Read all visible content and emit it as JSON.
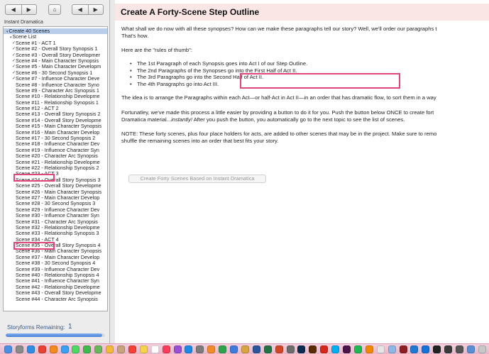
{
  "nav": {
    "back_glyph": "◀",
    "forward_glyph": "▶",
    "home_glyph": "⌂",
    "prev_glyph": "◀",
    "next_glyph": "▶"
  },
  "sidebar": {
    "document_label": "Instant Dramatica",
    "items": [
      {
        "label": "Create 40 Scenes",
        "level": 0,
        "selected": true,
        "checked": false,
        "expander": "▾"
      },
      {
        "label": "Scene List",
        "level": 1,
        "selected": false,
        "checked": false,
        "expander": "▾"
      },
      {
        "label": "Scene #1 - ACT 1",
        "level": 2,
        "checked": true
      },
      {
        "label": "Scene #2 - Overall Story Synopsis 1",
        "level": 2,
        "checked": true
      },
      {
        "label": "Scene #3 - Overall Story Developmer",
        "level": 2,
        "checked": true
      },
      {
        "label": "Scene #4 - Main Character Synopsis",
        "level": 2,
        "checked": true
      },
      {
        "label": "Scene #5 - Main Character Developm",
        "level": 2,
        "checked": true
      },
      {
        "label": "Scene #6 - 30 Second Synopsis 1",
        "level": 2,
        "checked": true
      },
      {
        "label": "Scene #7 - Influence Character Deve",
        "level": 2,
        "checked": true
      },
      {
        "label": "Scene #8 - Influence Character Syno",
        "level": 2,
        "checked": false
      },
      {
        "label": "Scene #9 - Character Arc Synopsis 1",
        "level": 2,
        "checked": false
      },
      {
        "label": "Scene #10 - Relationship Developme",
        "level": 2,
        "checked": false
      },
      {
        "label": "Scene #11 - Relationship Synopsis 1",
        "level": 2,
        "checked": false
      },
      {
        "label": "Scene #12 - ACT 2",
        "level": 2,
        "checked": false
      },
      {
        "label": "Scene #13 - Overall Story Synopsis 2",
        "level": 2,
        "checked": false
      },
      {
        "label": "Scene #14 - Overall Story Developme",
        "level": 2,
        "checked": false
      },
      {
        "label": "Scene #15 - Main Character Synopsis",
        "level": 2,
        "checked": false
      },
      {
        "label": "Scene #16 - Main Character Develop",
        "level": 2,
        "checked": false
      },
      {
        "label": "Scene #17 - 30 Second Synopsis 2",
        "level": 2,
        "checked": false
      },
      {
        "label": "Scene #18 - Influence Character Dev",
        "level": 2,
        "checked": false
      },
      {
        "label": "Scene #19 - Influence Character Syn",
        "level": 2,
        "checked": false
      },
      {
        "label": "Scene #20 - Character Arc Synopsis",
        "level": 2,
        "checked": false
      },
      {
        "label": "Scene #21 - Relationship Developme",
        "level": 2,
        "checked": false
      },
      {
        "label": "Scene #22 - Relationship Synopsis 2",
        "level": 2,
        "checked": false
      },
      {
        "label": "Scene #23 - ACT 3",
        "level": 2,
        "checked": false
      },
      {
        "label": "Scene #24 - Overall Story Synopsis 3",
        "level": 2,
        "checked": false
      },
      {
        "label": "Scene #25 - Overall Story Developme",
        "level": 2,
        "checked": false
      },
      {
        "label": "Scene #26 - Main Character Synopsis",
        "level": 2,
        "checked": false
      },
      {
        "label": "Scene #27 - Main Character Develop",
        "level": 2,
        "checked": false
      },
      {
        "label": "Scene #28 - 30 Second Synopsis 3",
        "level": 2,
        "checked": false
      },
      {
        "label": "Scene #29 - Influence Character Dev",
        "level": 2,
        "checked": false
      },
      {
        "label": "Scene #30 - Influence Character Syn",
        "level": 2,
        "checked": false
      },
      {
        "label": "Scene #31 - Character Arc Synopsis",
        "level": 2,
        "checked": false
      },
      {
        "label": "Scene #32 - Relationship Developme",
        "level": 2,
        "checked": false
      },
      {
        "label": "Scene #33 - Relationship Synopsis 3",
        "level": 2,
        "checked": false
      },
      {
        "label": "Scene #34 - ACT 4",
        "level": 2,
        "checked": false
      },
      {
        "label": "Scene #35 - Overall Story Synopsis 4",
        "level": 2,
        "checked": false
      },
      {
        "label": "Scene #36 - Main Character Synopsis",
        "level": 2,
        "checked": false
      },
      {
        "label": "Scene #37 - Main Character Develop",
        "level": 2,
        "checked": false
      },
      {
        "label": "Scene #38 - 30 Second Synopsis 4",
        "level": 2,
        "checked": false
      },
      {
        "label": "Scene #39 - Influence Character Dev",
        "level": 2,
        "checked": false
      },
      {
        "label": "Scene #40 - Relationship Synopsis 4",
        "level": 2,
        "checked": false
      },
      {
        "label": "Scene #41 - Influence Character Syn",
        "level": 2,
        "checked": false
      },
      {
        "label": "Scene #42 - Relationship Developme",
        "level": 2,
        "checked": false
      },
      {
        "label": "Scene #43 - Overall Story Developme",
        "level": 2,
        "checked": false
      },
      {
        "label": "Scene #44 - Character Arc Synopsis",
        "level": 2,
        "checked": false
      }
    ],
    "storyforms_label": "Storyforms Remaining:",
    "storyforms_count": "1",
    "storyforms_fill_fraction": 0.97
  },
  "main": {
    "title": "Create A Forty-Scene Step Outline",
    "intro_line1": "What shall we do now with all these synopses?  How can we make these paragraphs tell our story?   Well, we'll order our paragraphs t",
    "intro_line2": "That's how.",
    "rules_intro": "Here are the \"rules of thumb\":",
    "rules": [
      "The 1st Paragraph of each Synopsis goes into Act I of our Step Outline.",
      "The 2nd Paragraphs of the Synopses go into the First Half of Act II.",
      "The 3rd Paragraphs go into the Second Half of Act II.",
      "The 4th Paragraphs go into Act III."
    ],
    "idea": "The idea is to arrange the Paragraphs within each Act—or half-Act in Act II—in an order that has dramatic flow, to sort them in a way",
    "fortunately_line1": "Fortunatley, we've made this process a little easier by providing a button to do it for you.  Push the button below ONCE to create fort",
    "fortunately_line2_pre": "Dramatica material...",
    "fortunately_line2_em": "instantly!",
    "fortunately_line2_post": "  After you push the button, you automatically go to the next topic to see the list of scenes.",
    "note_line1": "NOTE: These forty scenes, plus four place holders for acts, are added to other scenes that may be in the project.  Make sure to remo",
    "note_line2": "shuffle the remaining scenes into an order that best fits your story.",
    "create_button_label": "Create Forty Scenes Based on Instant Dramatica"
  },
  "colors": {
    "highlight": "#e0457b",
    "title_bg": "#fbe6e6",
    "selection": "#b7cdea",
    "storyforms_text": "#3c5a88"
  },
  "dock": {
    "icons": [
      {
        "name": "finder-icon",
        "color": "#4a90e2"
      },
      {
        "name": "launchpad-icon",
        "color": "#8a8a8a"
      },
      {
        "name": "safari-icon",
        "color": "#2f8de4"
      },
      {
        "name": "chrome-icon",
        "color": "#e94235"
      },
      {
        "name": "firefox-icon",
        "color": "#f48a1e"
      },
      {
        "name": "mail-icon",
        "color": "#3aa0f3"
      },
      {
        "name": "messages-icon",
        "color": "#4cd964"
      },
      {
        "name": "facetime-icon",
        "color": "#3dbb4b"
      },
      {
        "name": "maps-icon",
        "color": "#68b85c"
      },
      {
        "name": "photos-icon",
        "color": "#f5b93a"
      },
      {
        "name": "contacts-icon",
        "color": "#c8a47a"
      },
      {
        "name": "calendar-icon",
        "color": "#f44336"
      },
      {
        "name": "notes-icon",
        "color": "#f7d54a"
      },
      {
        "name": "reminders-icon",
        "color": "#ffffff"
      },
      {
        "name": "music-icon",
        "color": "#fb3c5b"
      },
      {
        "name": "podcasts-icon",
        "color": "#9b4fd6"
      },
      {
        "name": "appstore-icon",
        "color": "#1e88e5"
      },
      {
        "name": "preferences-icon",
        "color": "#7d7d7d"
      },
      {
        "name": "pages-icon",
        "color": "#f28c28"
      },
      {
        "name": "numbers-icon",
        "color": "#2ea44f"
      },
      {
        "name": "keynote-icon",
        "color": "#3d7be0"
      },
      {
        "name": "dramatica-icon",
        "color": "#d9a441"
      },
      {
        "name": "word-icon",
        "color": "#2b579a"
      },
      {
        "name": "excel-icon",
        "color": "#217346"
      },
      {
        "name": "powerpoint-icon",
        "color": "#d24726"
      },
      {
        "name": "scrivener-icon",
        "color": "#6d6d6d"
      },
      {
        "name": "photoshop-icon",
        "color": "#0d2b4f"
      },
      {
        "name": "illustrator-icon",
        "color": "#5a2a00"
      },
      {
        "name": "acrobat-icon",
        "color": "#d9261c"
      },
      {
        "name": "skype-icon",
        "color": "#00aff0"
      },
      {
        "name": "slack-icon",
        "color": "#4a154b"
      },
      {
        "name": "spotify-icon",
        "color": "#1db954"
      },
      {
        "name": "vlc-icon",
        "color": "#f08a00"
      },
      {
        "name": "textedit-icon",
        "color": "#e5e5e5"
      },
      {
        "name": "preview-icon",
        "color": "#8fb7e6"
      },
      {
        "name": "dictionary-icon",
        "color": "#8b1e1e"
      },
      {
        "name": "vscode-icon",
        "color": "#1f7ad4"
      },
      {
        "name": "xcode-icon",
        "color": "#1572d6"
      },
      {
        "name": "terminal-icon",
        "color": "#222222"
      },
      {
        "name": "activity-icon",
        "color": "#3a3a3a"
      },
      {
        "name": "console-icon",
        "color": "#555555"
      },
      {
        "name": "downloads-icon",
        "color": "#5b8fd3"
      },
      {
        "name": "trash-icon",
        "color": "#c8c8c8"
      }
    ]
  }
}
